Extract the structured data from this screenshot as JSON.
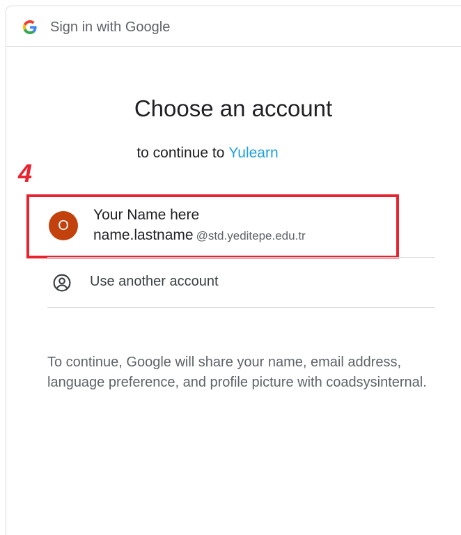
{
  "header": {
    "title": "Sign in with Google"
  },
  "main": {
    "title": "Choose an account",
    "subtitle_prefix": "to continue to",
    "app_name": "Yulearn"
  },
  "annotation": {
    "step": "4"
  },
  "account": {
    "avatar_letter": "O",
    "name": "Your Name here",
    "email_user": "name.lastname",
    "email_domain": "@std.yeditepe.edu.tr"
  },
  "other_account": {
    "label": "Use another account"
  },
  "notice": {
    "text": "To continue, Google will share your name, email address, language preference, and profile picture with coadsysinternal."
  },
  "colors": {
    "annotation_red": "#e8232f",
    "avatar_bg": "#c2410c",
    "link_blue": "#1a9fe0"
  }
}
